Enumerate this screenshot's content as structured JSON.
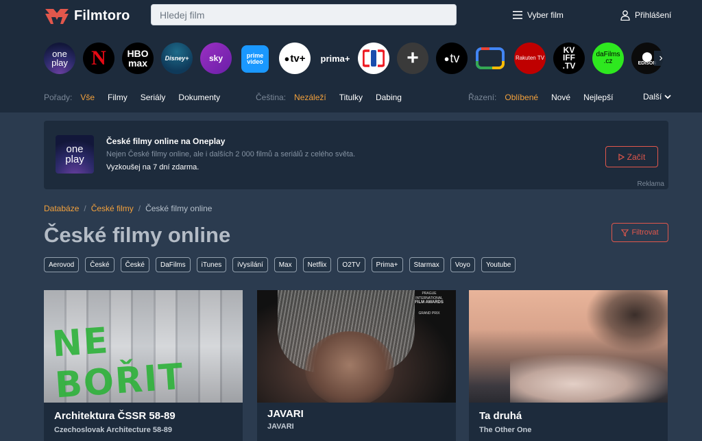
{
  "header": {
    "logo_text": "Filmtoro",
    "search_placeholder": "Hledej film",
    "vyber_label": "Vyber film",
    "login_label": "Přihlášení"
  },
  "providers": [
    {
      "name": "oneplay",
      "label1": "one",
      "label2": "play"
    },
    {
      "name": "netflix",
      "label": "N"
    },
    {
      "name": "hbo-max",
      "label1": "HBO",
      "label2": "max"
    },
    {
      "name": "disney-plus",
      "label": "Disney+"
    },
    {
      "name": "skyshowtime",
      "label": "sky"
    },
    {
      "name": "prime-video",
      "label1": "prime",
      "label2": "video"
    },
    {
      "name": "apple-tv-plus",
      "label": "tv+"
    },
    {
      "name": "prima-plus",
      "label": "prima+"
    },
    {
      "name": "ceska-televize",
      "label": ""
    },
    {
      "name": "voyo",
      "label": "+"
    },
    {
      "name": "apple-tv",
      "label": "tv"
    },
    {
      "name": "google-tv",
      "label": ""
    },
    {
      "name": "rakuten-tv",
      "label": "Rakuten TV"
    },
    {
      "name": "kviff-tv",
      "label1": "KV",
      "label2": "IFF",
      "label3": ".TV"
    },
    {
      "name": "dafilms",
      "label1": "daFilms",
      "label2": ".cz"
    },
    {
      "name": "edisonline",
      "label": "EDISON"
    }
  ],
  "filters": {
    "porady": {
      "label": "Pořady:",
      "items": [
        "Vše",
        "Filmy",
        "Seriály",
        "Dokumenty"
      ],
      "active": 0
    },
    "cestina": {
      "label": "Čeština:",
      "items": [
        "Nezáleží",
        "Titulky",
        "Dabing"
      ],
      "active": 0
    },
    "razeni": {
      "label": "Řazení:",
      "items": [
        "Oblíbené",
        "Nové",
        "Nejlepší"
      ],
      "active": 0
    },
    "dalsi": "Další"
  },
  "ad": {
    "logo1": "one",
    "logo2": "play",
    "title": "České filmy online na Oneplay",
    "subtitle": "Nejen České filmy online, ale i dalších 2 000 filmů a seriálů z celého světa.",
    "trial": "Vyzkoušej na 7 dní zdarma.",
    "button": "Začít",
    "tag": "Reklama"
  },
  "breadcrumb": {
    "item1": "Databáze",
    "item2": "České filmy",
    "current": "České filmy online",
    "sep": "/"
  },
  "page_title": "České filmy online",
  "filter_button": "Filtrovat",
  "tags": [
    "Aerovod",
    "České",
    "České",
    "DaFilms",
    "iTunes",
    "iVysílání",
    "Max",
    "Netflix",
    "O2TV",
    "Prima+",
    "Starmax",
    "Voyo",
    "Youtube"
  ],
  "cards": [
    {
      "title": "Architektura ČSSR 58-89",
      "original": "Czechoslovak Architecture 58-89",
      "image_text": "NE BOŘIT"
    },
    {
      "title": "JAVARI",
      "original": "JAVARI",
      "award1": "PRAGUE INTERNATIONAL",
      "award2": "FILM AWARDS",
      "award3": "GRAND PRIX"
    },
    {
      "title": "Ta druhá",
      "original": "The Other One"
    }
  ],
  "colors": {
    "accent_orange": "#f3a13c",
    "accent_red": "#e2574c",
    "bg_dark": "#1d2b3c",
    "bg_main": "#2b3b4f"
  }
}
